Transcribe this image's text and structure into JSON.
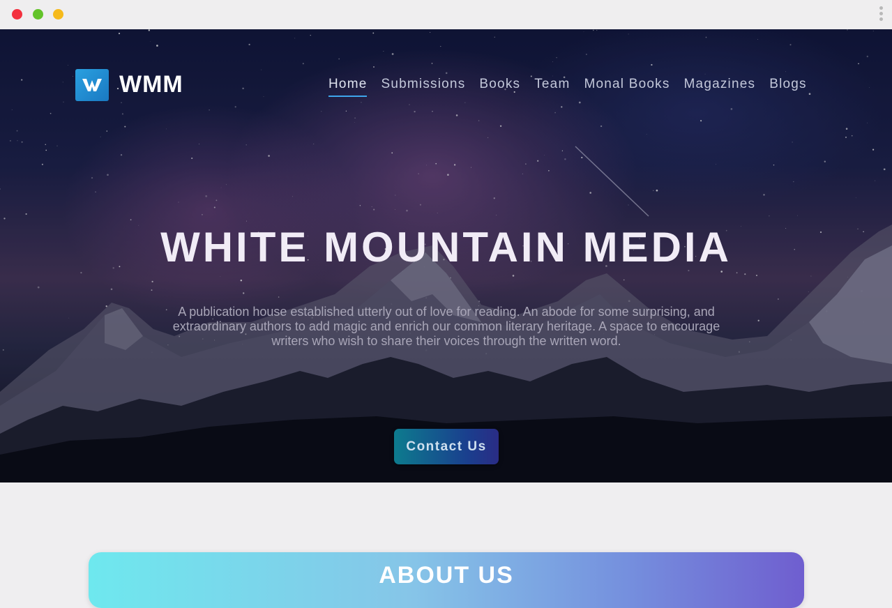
{
  "window": {
    "controls": [
      "close",
      "minimize",
      "maximize"
    ],
    "menu_icon": "kebab-menu-icon"
  },
  "brand": {
    "logo_icon": "wmm-logo-icon",
    "name": "WMM"
  },
  "nav": {
    "items": [
      {
        "label": "Home",
        "active": true
      },
      {
        "label": "Submissions"
      },
      {
        "label": "Books"
      },
      {
        "label": "Team"
      },
      {
        "label": "Monal Books"
      },
      {
        "label": "Magazines"
      },
      {
        "label": "Blogs"
      }
    ]
  },
  "hero": {
    "title": "WHITE MOUNTAIN MEDIA",
    "description": "A publication house established utterly out of love for reading. An abode for some surprising, and extraordinary authors to add magic and enrich our common literary heritage. A space to encourage writers who wish to share their voices through the written word.",
    "cta_label": "Contact Us"
  },
  "about": {
    "title": "ABOUT US"
  },
  "colors": {
    "accent": "#3ea6ec",
    "logo": "#2196dc",
    "cta_start": "#0d7b8e",
    "cta_end": "#2a2c85"
  }
}
